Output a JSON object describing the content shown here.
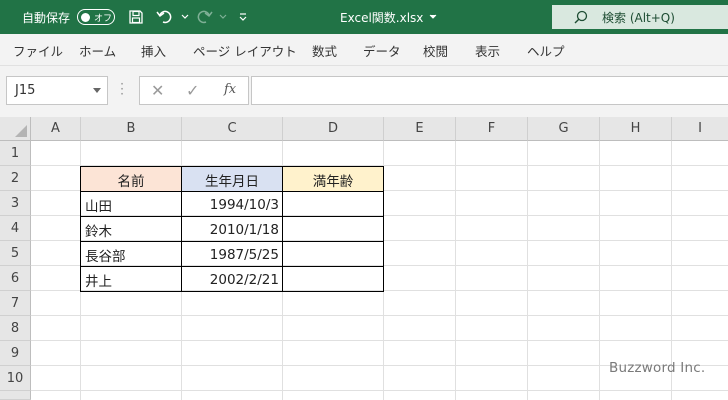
{
  "titlebar": {
    "autosave_label": "自動保存",
    "autosave_state": "オフ",
    "file_title": "Excel関数.xlsx",
    "search_label": "検索 (Alt+Q)",
    "icons": [
      "save-icon",
      "undo-icon",
      "redo-icon",
      "customize-icon",
      "search-icon"
    ]
  },
  "menu": {
    "items": [
      "ファイル",
      "ホーム",
      "挿入",
      "ページ レイアウト",
      "数式",
      "データ",
      "校閲",
      "表示",
      "ヘルプ"
    ]
  },
  "formula_bar": {
    "name_box": "J15",
    "fx_label": "fx",
    "formula": ""
  },
  "sheet": {
    "columns": [
      "A",
      "B",
      "C",
      "D",
      "E",
      "F",
      "G",
      "H",
      "I"
    ],
    "rows": [
      "1",
      "2",
      "3",
      "4",
      "5",
      "6",
      "7",
      "8",
      "9",
      "10"
    ],
    "table": {
      "headers": [
        "名前",
        "生年月日",
        "満年齢"
      ],
      "header_colors": [
        "#fce4d6",
        "#d9e1f2",
        "#fff2cc"
      ],
      "rows": [
        {
          "name": "山田",
          "birthdate": "1994/10/3",
          "age": ""
        },
        {
          "name": "鈴木",
          "birthdate": "2010/1/18",
          "age": ""
        },
        {
          "name": "長谷部",
          "birthdate": "1987/5/25",
          "age": ""
        },
        {
          "name": "井上",
          "birthdate": "2002/2/21",
          "age": ""
        }
      ]
    }
  },
  "watermark": "Buzzword Inc.",
  "colors": {
    "accent": "#217346",
    "search_bg": "#d9e8df"
  }
}
